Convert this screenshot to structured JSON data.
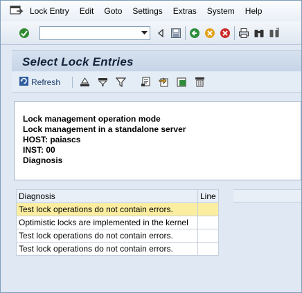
{
  "menubar": {
    "items": [
      "Lock Entry",
      "Edit",
      "Goto",
      "Settings",
      "Extras",
      "System",
      "Help"
    ]
  },
  "toolbar": {
    "command_field": {
      "value": "",
      "placeholder": ""
    },
    "icons": [
      "enter-icon",
      "back-arrow-icon",
      "save-icon",
      "back-icon",
      "exit-icon",
      "cancel-icon",
      "print-icon",
      "find-icon",
      "find-next-icon"
    ]
  },
  "page": {
    "title": "Select Lock Entries"
  },
  "app_toolbar": {
    "refresh_label": "Refresh",
    "icons": [
      "select-all-icon",
      "filter-icon",
      "set-filter-icon",
      "details-icon",
      "export-icon",
      "display-icon",
      "trash-icon"
    ]
  },
  "info": {
    "lines": [
      "Lock management operation mode",
      "Lock management in a standalone server",
      "HOST: paiascs",
      "INST: 00",
      "Diagnosis"
    ]
  },
  "table": {
    "headers": [
      "Diagnosis",
      "Line"
    ],
    "rows": [
      {
        "diagnosis": "Test lock operations do not contain errors.",
        "line": "",
        "selected": true
      },
      {
        "diagnosis": "Optimistic locks are implemented in the kernel",
        "line": "",
        "selected": false
      },
      {
        "diagnosis": "Test lock operations do not contain errors.",
        "line": "",
        "selected": false
      },
      {
        "diagnosis": "Test lock operations do not contain errors.",
        "line": "",
        "selected": false
      }
    ]
  },
  "colors": {
    "selected_row": "#fbeea1",
    "background": "#dfe8f3",
    "title_text": "#13233b"
  }
}
